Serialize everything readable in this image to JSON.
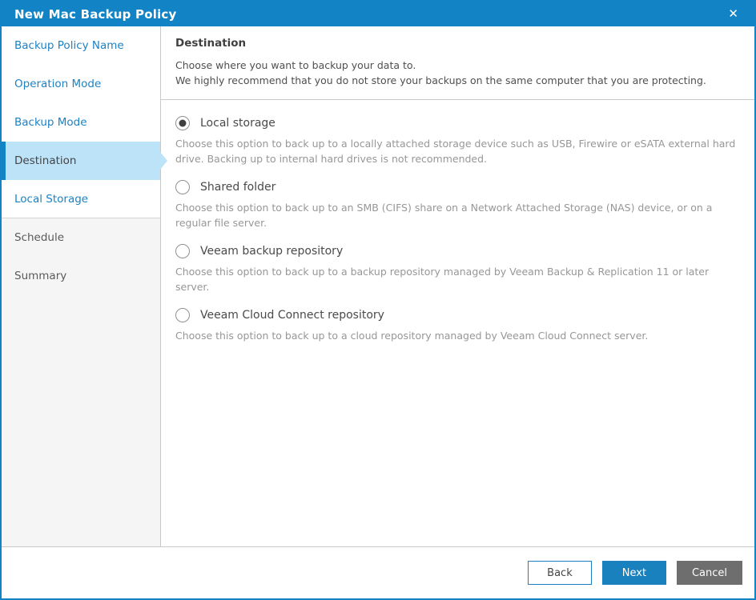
{
  "window": {
    "title": "New Mac Backup Policy",
    "close_icon": "✕"
  },
  "colors": {
    "primary_blue": "#1283c4",
    "link_blue": "#1d82c4",
    "selected_item_bg": "#bde3f8",
    "sidebar_bg": "#f5f5f5",
    "disabled_text": "#5a5a5a",
    "body_text": "#4a4a4a",
    "muted_text": "#979797",
    "next_button_bg": "#1981bd",
    "cancel_button_bg": "#6e6e6e",
    "border_gray": "#c9c9c9"
  },
  "sidebar": {
    "items": [
      {
        "label": "Backup Policy Name",
        "state": "link"
      },
      {
        "label": "Operation Mode",
        "state": "link"
      },
      {
        "label": "Backup Mode",
        "state": "link"
      },
      {
        "label": "Destination",
        "state": "selected"
      },
      {
        "label": "Local Storage",
        "state": "link"
      },
      {
        "label": "Schedule",
        "state": "disabled"
      },
      {
        "label": "Summary",
        "state": "disabled"
      }
    ]
  },
  "header": {
    "title": "Destination",
    "line1": "Choose where you want to backup your data to.",
    "line2": "We highly recommend that you do not store your backups on the same computer that you are protecting."
  },
  "options": [
    {
      "label": "Local storage",
      "selected": true,
      "description": "Choose this option to back up to a locally attached storage device such as USB, Firewire or eSATA external hard drive. Backing up to internal hard drives is not recommended."
    },
    {
      "label": "Shared folder",
      "selected": false,
      "description": "Choose this option to back up to an SMB (CIFS) share on a Network Attached Storage (NAS) device, or on a regular file server."
    },
    {
      "label": "Veeam backup repository",
      "selected": false,
      "description": "Choose this option to back up to a backup repository managed by Veeam Backup & Replication 11 or later server."
    },
    {
      "label": "Veeam Cloud Connect repository",
      "selected": false,
      "description": "Choose this option to back up to a cloud repository managed by Veeam Cloud Connect server."
    }
  ],
  "footer": {
    "back_label": "Back",
    "next_label": "Next",
    "cancel_label": "Cancel"
  }
}
